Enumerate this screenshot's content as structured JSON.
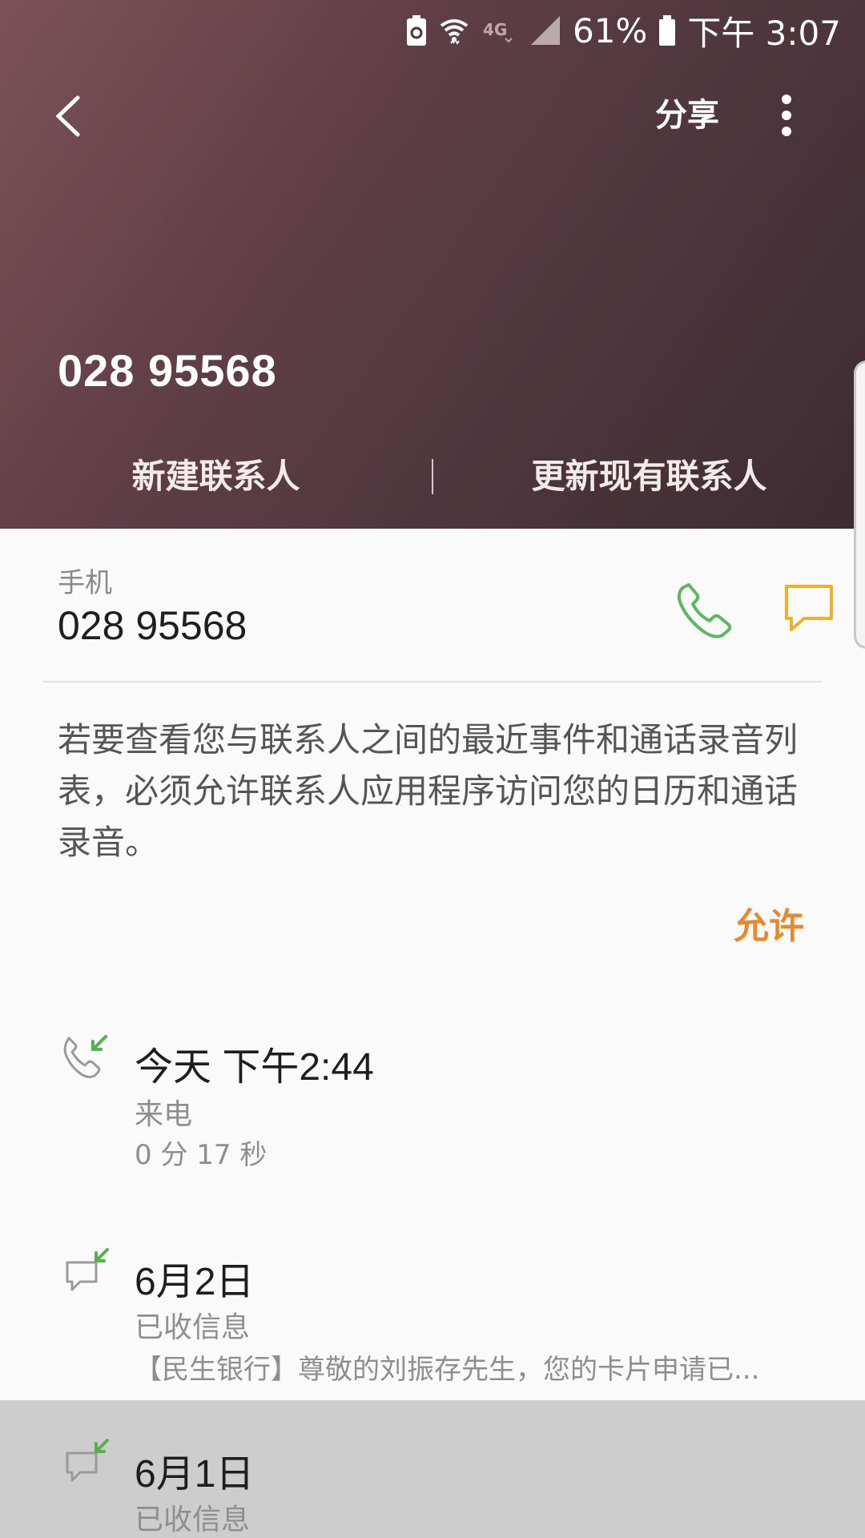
{
  "status_bar": {
    "battery_percent": "61%",
    "time": "下午 3:07",
    "icons": [
      "battery-saver-icon",
      "wifi-icon",
      "4g-icon",
      "signal-icon",
      "battery-icon"
    ]
  },
  "toolbar": {
    "share_label": "分享"
  },
  "contact": {
    "number": "028 95568"
  },
  "actions": {
    "new_contact": "新建联系人",
    "update_existing": "更新现有联系人"
  },
  "phone": {
    "type": "手机",
    "number": "028 95568"
  },
  "permission": {
    "message": "若要查看您与联系人之间的最近事件和通话录音列表，必须允许联系人应用程序访问您的日历和通话录音。",
    "allow_label": "允许"
  },
  "log": [
    {
      "date": "今天 下午2:44",
      "type": "来电",
      "detail": "0 分 17 秒",
      "icon": "incoming-call-icon"
    },
    {
      "date": "6月2日",
      "type": "已收信息",
      "detail": "【民生银行】尊敬的刘振存先生，您的卡片申请已...",
      "icon": "received-message-icon"
    },
    {
      "date": "6月1日",
      "type": "已收信息",
      "icon": "received-message-icon"
    }
  ],
  "colors": {
    "header_gradient_start": "#7c5259",
    "header_gradient_end": "#3d2b31",
    "call_green": "#5cb85c",
    "message_orange": "#f0b12a",
    "allow_orange": "#e8892f",
    "arrow_green": "#55b24a"
  }
}
